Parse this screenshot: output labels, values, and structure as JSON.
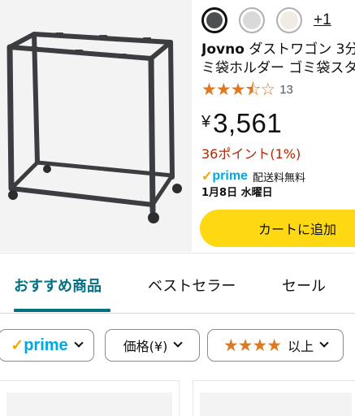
{
  "product": {
    "image_alt": "Jovno dust wagon rack",
    "swatches": [
      "dark-grey",
      "light-grey",
      "cream"
    ],
    "more_swatches": "+1",
    "title_brand": "Jovno",
    "title_line1_rest": " ダストワゴン 3分",
    "title_line2": "ミ袋ホルダー ゴミ袋スタ",
    "rating_value": 3.5,
    "rating_stars": "★★★⯪☆",
    "rating_count": "13",
    "price_symbol": "¥",
    "price_amount": "3,561",
    "points": "36ポイント(1%)",
    "prime_check": "✓",
    "prime_label": "prime",
    "shipping": "配送料無料",
    "delivery": "1月8日 水曜日",
    "add_to_cart": "カートに追加"
  },
  "tabs": [
    {
      "label": "おすすめ商品",
      "active": true
    },
    {
      "label": "ベストセラー",
      "active": false
    },
    {
      "label": "セール",
      "active": false
    }
  ],
  "filters": {
    "prime_check": "✓",
    "prime_label": "prime",
    "price_label": "価格(¥)",
    "stars_glyphs": "★★★★",
    "stars_label": "以上"
  },
  "colors": {
    "accent_teal": "#007185",
    "star_orange": "#de7921",
    "price_red": "#b12704",
    "prime_blue": "#00a8e1",
    "cart_yellow": "#ffd814"
  }
}
